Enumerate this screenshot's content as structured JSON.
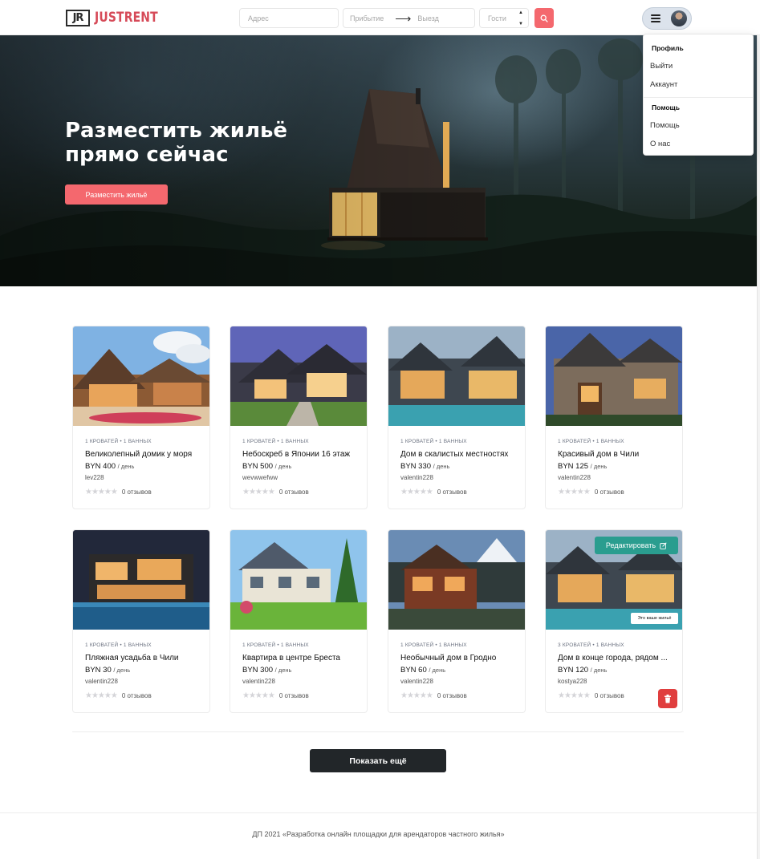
{
  "brand": {
    "mark": "JR",
    "name": "JUSTRENT",
    "accent": "#f4686e",
    "logo_red": "#d64a58"
  },
  "search": {
    "address_placeholder": "Адрес",
    "checkin_placeholder": "Прибытие",
    "checkout_placeholder": "Выезд",
    "guests_placeholder": "Гости",
    "search_icon": "search-icon"
  },
  "user_menu": {
    "sections": [
      {
        "heading": "Профиль",
        "items": [
          "Выйти",
          "Аккаунт"
        ]
      },
      {
        "heading": "Помощь",
        "items": [
          "Помощь",
          "О нас"
        ]
      }
    ]
  },
  "hero": {
    "title": "Разместить жильё прямо сейчас",
    "button_label": "Разместить жильё"
  },
  "listings": [
    {
      "meta": "1 кроватей • 1 ванных",
      "title": "Великолепный домик у моря",
      "price": "BYN 400",
      "per": "/ день",
      "owner": "lev228",
      "reviews": "0 отзывов",
      "owned": false
    },
    {
      "meta": "1 кроватей • 1 ванных",
      "title": "Небоскреб в Японии 16 этаж",
      "price": "BYN 500",
      "per": "/ день",
      "owner": "wevwwefww",
      "reviews": "0 отзывов",
      "owned": false
    },
    {
      "meta": "1 кроватей • 1 ванных",
      "title": "Дом в скалистых местностях",
      "price": "BYN 330",
      "per": "/ день",
      "owner": "valentin228",
      "reviews": "0 отзывов",
      "owned": false
    },
    {
      "meta": "1 кроватей • 1 ванных",
      "title": "Красивый дом в Чили",
      "price": "BYN 125",
      "per": "/ день",
      "owner": "valentin228",
      "reviews": "0 отзывов",
      "owned": false
    },
    {
      "meta": "1 кроватей • 1 ванных",
      "title": "Пляжная усадьба в Чили",
      "price": "BYN 30",
      "per": "/ день",
      "owner": "valentin228",
      "reviews": "0 отзывов",
      "owned": false
    },
    {
      "meta": "1 кроватей • 1 ванных",
      "title": "Квартира в центре Бреста",
      "price": "BYN 300",
      "per": "/ день",
      "owner": "valentin228",
      "reviews": "0 отзывов",
      "owned": false
    },
    {
      "meta": "1 кроватей • 1 ванных",
      "title": "Необычный дом в Гродно",
      "price": "BYN 60",
      "per": "/ день",
      "owner": "valentin228",
      "reviews": "0 отзывов",
      "owned": false
    },
    {
      "meta": "3 кроватей • 1 ванных",
      "title": "Дом в конце города, рядом ...",
      "price": "BYN 120",
      "per": "/ день",
      "owner": "kostya228",
      "reviews": "0 отзывов",
      "owned": true
    }
  ],
  "owned_card": {
    "edit_label": "Редактировать",
    "edit_icon": "edit-icon",
    "badge": "Это ваше жильё",
    "delete_icon": "trash-icon",
    "edit_color": "#2a9d8f",
    "delete_color": "#e03e3e"
  },
  "show_more_label": "Показать ещё",
  "footer_text": "ДП 2021 «Разработка онлайн площадки для арендаторов частного жилья»"
}
